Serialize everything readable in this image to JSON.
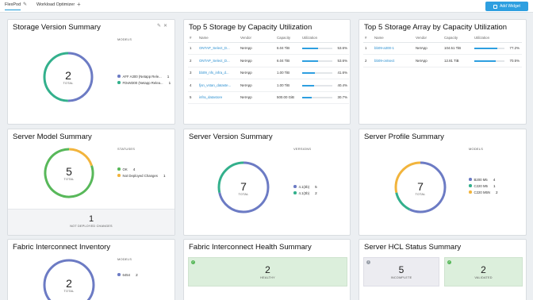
{
  "topbar": {
    "tabs": [
      {
        "label": "FlexPod"
      },
      {
        "label": "Workload Optimizer"
      }
    ],
    "add_widget_label": "Add Widget"
  },
  "storage_version": {
    "title": "Storage Version Summary",
    "total": "2",
    "total_label": "TOTAL",
    "legend_head": "MODELS",
    "items": [
      {
        "label": "AFF A300 (Netapp Rele...",
        "count": "1",
        "color": "#6c7bc4"
      },
      {
        "label": "FDvM300 (Netapp Relea...",
        "count": "1",
        "color": "#33b08c"
      }
    ]
  },
  "top_storage_util": {
    "title": "Top 5 Storage by Capacity Utilization",
    "columns": [
      "#",
      "Name",
      "Vendor",
      "Capacity",
      "Utilization"
    ],
    "rows": [
      {
        "n": "1",
        "name": "ONTAP_Select_D...",
        "vendor": "NetApp",
        "capacity": "6.04 TiB",
        "pct": "53.6%",
        "value": 53.6
      },
      {
        "n": "2",
        "name": "ONTAP_Select_D...",
        "vendor": "NetApp",
        "capacity": "6.04 TiB",
        "pct": "53.6%",
        "value": 53.6
      },
      {
        "n": "3",
        "name": "bb09_nfs_infra_d...",
        "vendor": "NetApp",
        "capacity": "1.00 TiB",
        "pct": "41.6%",
        "value": 41.6
      },
      {
        "n": "4",
        "name": "fjsn_vstan_dataste...",
        "vendor": "NetApp",
        "capacity": "1.00 TiB",
        "pct": "40.4%",
        "value": 40.4
      },
      {
        "n": "5",
        "name": "infra_datastore",
        "vendor": "NetApp",
        "capacity": "500.00 GiB",
        "pct": "30.7%",
        "value": 30.7
      }
    ]
  },
  "top_array_util": {
    "title": "Top 5 Storage Array by Capacity Utilization",
    "columns": [
      "#",
      "Name",
      "Vendor",
      "Capacity",
      "Utilization"
    ],
    "rows": [
      {
        "n": "1",
        "name": "bb09-a300-1",
        "vendor": "NetApp",
        "capacity": "104.51 TiB",
        "pct": "77.2%",
        "value": 77.2
      },
      {
        "n": "2",
        "name": "bb09-ontsect",
        "vendor": "NetApp",
        "capacity": "12.81 TiB",
        "pct": "70.5%",
        "value": 70.5
      }
    ]
  },
  "server_model": {
    "title": "Server Model Summary",
    "total": "5",
    "total_label": "TOTAL",
    "legend_head": "STATUSES",
    "items": [
      {
        "label": "OK",
        "count": "4",
        "color": "#58b85a"
      },
      {
        "label": "Not Deployed Changes",
        "count": "1",
        "color": "#f2b43c"
      }
    ],
    "footer_num": "1",
    "footer_label": "NOT DEPLOYED CHANGES"
  },
  "server_version": {
    "title": "Server Version Summary",
    "total": "7",
    "total_label": "TOTAL",
    "legend_head": "VERSIONS",
    "items": [
      {
        "label": "4.1(3b)",
        "count": "5",
        "color": "#6c7bc4"
      },
      {
        "label": "4.1(3b)",
        "count": "2",
        "color": "#33b08c"
      }
    ]
  },
  "server_profile": {
    "title": "Server Profile Summary",
    "total": "7",
    "total_label": "TOTAL",
    "legend_head": "MODELS",
    "items": [
      {
        "label": "B200 M5",
        "count": "4",
        "color": "#6c7bc4"
      },
      {
        "label": "C220 M5",
        "count": "1",
        "color": "#33b08c"
      },
      {
        "label": "C220 M5N",
        "count": "2",
        "color": "#f2b43c"
      }
    ]
  },
  "fi_inventory": {
    "title": "Fabric Interconnect Inventory",
    "total": "2",
    "total_label": "TOTAL",
    "legend_head": "MODELS",
    "items": [
      {
        "label": "6454",
        "count": "2",
        "color": "#6c7bc4"
      }
    ]
  },
  "fi_health": {
    "title": "Fabric Interconnect Health Summary",
    "tile": {
      "num": "2",
      "label": "HEALTHY",
      "icon": "check-circle-icon",
      "color": "#58b85a"
    }
  },
  "hcl_status": {
    "title": "Server HCL Status Summary",
    "tiles": [
      {
        "num": "5",
        "label": "INCOMPLETE",
        "icon": "info-circle-icon",
        "color": "#9aa0aa"
      },
      {
        "num": "2",
        "label": "VALIDATED",
        "icon": "check-circle-icon",
        "color": "#58b85a"
      }
    ]
  }
}
